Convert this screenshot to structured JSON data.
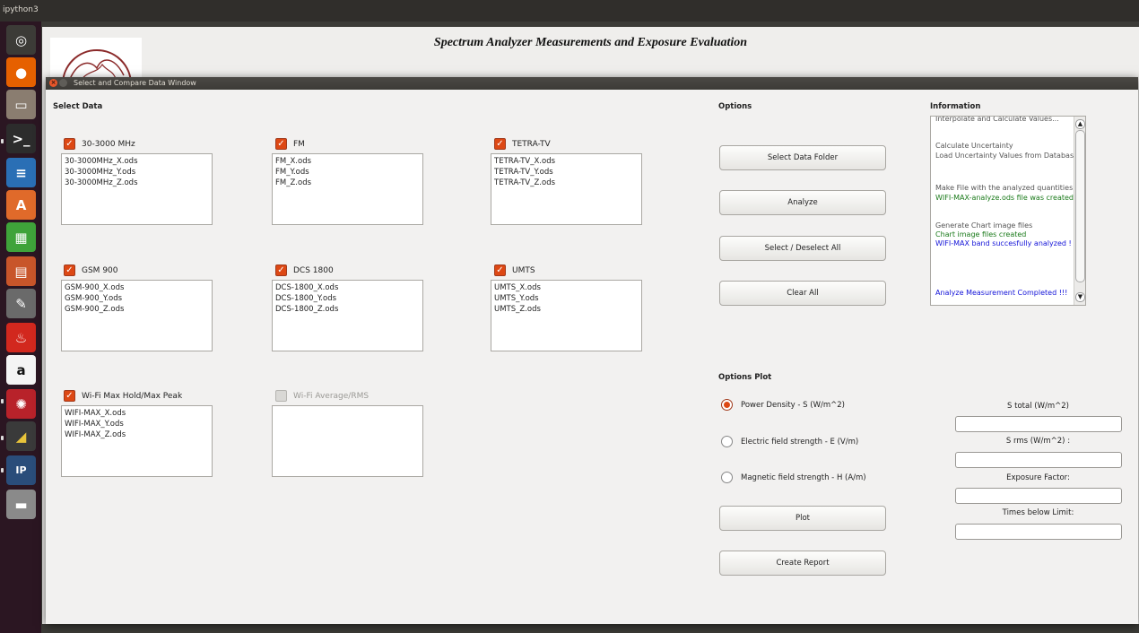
{
  "system": {
    "app_name": "ipython3"
  },
  "launcher": {
    "icons": [
      {
        "name": "ubuntu-dash-icon",
        "glyph": "◎",
        "color": "#3c3b37"
      },
      {
        "name": "firefox-icon",
        "glyph": "●",
        "color": "#e66000"
      },
      {
        "name": "files-icon",
        "glyph": "▭",
        "color": "#8a7d70"
      },
      {
        "name": "terminal-icon",
        "glyph": ">_",
        "color": "#2c2c2c"
      },
      {
        "name": "writer-icon",
        "glyph": "≡",
        "color": "#2a6fb5"
      },
      {
        "name": "software-center-icon",
        "glyph": "A",
        "color": "#e06a2a"
      },
      {
        "name": "calc-icon",
        "glyph": "▦",
        "color": "#3fa33a"
      },
      {
        "name": "impress-icon",
        "glyph": "▤",
        "color": "#c8552a"
      },
      {
        "name": "settings-icon",
        "glyph": "✎",
        "color": "#6a6a6a"
      },
      {
        "name": "fire-icon",
        "glyph": "♨",
        "color": "#d2281e"
      },
      {
        "name": "amazon-icon",
        "glyph": "a",
        "color": "#f4f4f4"
      },
      {
        "name": "web-icon",
        "glyph": "✺",
        "color": "#b8222a"
      },
      {
        "name": "ruler-icon",
        "glyph": "◢",
        "color": "#3a3a3a"
      },
      {
        "name": "ipython-icon",
        "glyph": "IP",
        "color": "#2a4d7a"
      },
      {
        "name": "drive-icon",
        "glyph": "▬",
        "color": "#8a8a8a"
      }
    ]
  },
  "main_window": {
    "title": "Spectrum Analyzer Measurements and Exposure Evaluation"
  },
  "dialog": {
    "title": "Select and Compare Data Window",
    "close_glyph": "×",
    "select_data_label": "Select Data",
    "options_label": "Options",
    "information_label": "Information",
    "options_plot_label": "Options Plot",
    "check_glyph": "✓",
    "groups": [
      {
        "label": "30-3000 MHz",
        "checked": true,
        "files": [
          "30-3000MHz_X.ods",
          "30-3000MHz_Y.ods",
          "30-3000MHz_Z.ods"
        ]
      },
      {
        "label": "FM",
        "checked": true,
        "files": [
          "FM_X.ods",
          "FM_Y.ods",
          "FM_Z.ods"
        ]
      },
      {
        "label": "TETRA-TV",
        "checked": true,
        "files": [
          "TETRA-TV_X.ods",
          "TETRA-TV_Y.ods",
          "TETRA-TV_Z.ods"
        ]
      },
      {
        "label": "GSM 900",
        "checked": true,
        "files": [
          "GSM-900_X.ods",
          "GSM-900_Y.ods",
          "GSM-900_Z.ods"
        ]
      },
      {
        "label": "DCS 1800",
        "checked": true,
        "files": [
          "DCS-1800_X.ods",
          "DCS-1800_Y.ods",
          "DCS-1800_Z.ods"
        ]
      },
      {
        "label": "UMTS",
        "checked": true,
        "files": [
          "UMTS_X.ods",
          "UMTS_Y.ods",
          "UMTS_Z.ods"
        ]
      },
      {
        "label": "Wi-Fi Max Hold/Max Peak",
        "checked": true,
        "files": [
          "WIFI-MAX_X.ods",
          "WIFI-MAX_Y.ods",
          "WIFI-MAX_Z.ods"
        ]
      },
      {
        "label": "Wi-Fi Average/RMS",
        "checked": false,
        "files": []
      }
    ],
    "buttons": {
      "select_data_folder": "Select Data Folder",
      "analyze": "Analyze",
      "select_deselect_all": "Select / Deselect All",
      "clear_all": "Clear All",
      "plot": "Plot",
      "create_report": "Create Report"
    },
    "information": {
      "lines": [
        {
          "text": "Interpolate and Calculate Values...",
          "style": "gray"
        },
        {
          "text": "Calculate Uncertainty",
          "style": "gray"
        },
        {
          "text": "Load Uncertainty Values from Database",
          "style": "gray"
        },
        {
          "text": "Make File with the analyzed quantities",
          "style": "gray"
        },
        {
          "text": "WIFI-MAX-analyze.ods file was created",
          "style": "green"
        },
        {
          "text": "Generate Chart image files",
          "style": "gray"
        },
        {
          "text": "Chart image files created",
          "style": "green"
        },
        {
          "text": "WIFI-MAX band succesfully analyzed !",
          "style": "blue"
        },
        {
          "text": "Analyze Measurement Completed !!!",
          "style": "blue"
        }
      ]
    },
    "plot_options": [
      {
        "label": "Power Density - S (W/m^2)",
        "selected": true
      },
      {
        "label": "Electric field strength - E (V/m)",
        "selected": false
      },
      {
        "label": "Magnetic field strength - H (A/m)",
        "selected": false
      }
    ],
    "results": {
      "s_total_label": "S total (W/m^2)",
      "s_total_value": "",
      "s_rms_label": "S rms (W/m^2) :",
      "s_rms_value": "",
      "exposure_factor_label": "Exposure Factor:",
      "exposure_factor_value": "",
      "times_below_limit_label": "Times below Limit:",
      "times_below_limit_value": ""
    }
  }
}
